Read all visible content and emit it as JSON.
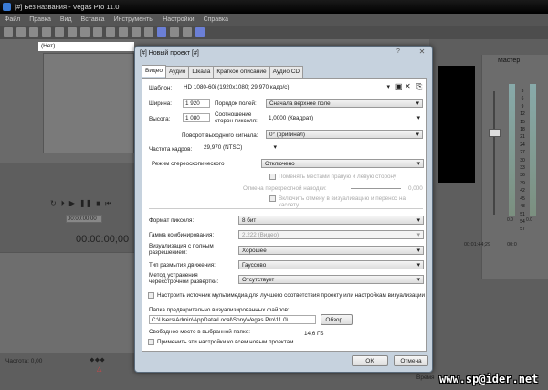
{
  "window": {
    "title": "[#] Без названия - Vegas Pro 11.0"
  },
  "menu": [
    "Файл",
    "Правка",
    "Вид",
    "Вставка",
    "Инструменты",
    "Настройки",
    "Справка"
  ],
  "preview": {
    "preset": "(Нет)",
    "time_small": "00:00:00;00",
    "timecode": "00:00:00;00"
  },
  "timeline": {
    "freq_label": "Частота: 0,00",
    "ruler": [
      "00:01:44;29",
      "00:0"
    ],
    "status": "Время"
  },
  "mixer": {
    "label": "Мастер",
    "scale": [
      "3",
      "6",
      "9",
      "12",
      "15",
      "18",
      "21",
      "24",
      "27",
      "30",
      "33",
      "36",
      "39",
      "42",
      "45",
      "48",
      "51",
      "54",
      "57"
    ],
    "left_level": "0.0",
    "right_level": "0.0"
  },
  "watermark": "www.sp@ider.net",
  "dialog": {
    "title": "[#] Новый проект [#]",
    "help": "?",
    "tabs": [
      "Видео",
      "Аудио",
      "Шкала",
      "Краткое описание",
      "Аудио CD"
    ],
    "template_label": "Шаблон:",
    "template_value": "HD 1080-60i (1920x1080; 29,970 кадр/с)",
    "width_label": "Ширина:",
    "width_value": "1 920",
    "height_label": "Высота:",
    "height_value": "1 080",
    "field_order_label": "Порядок полей:",
    "field_order_value": "Сначала верхнее поле",
    "pixel_aspect_label": "Соотношение сторон пикселя:",
    "pixel_aspect_value": "1,0000 (Квадрат)",
    "rotation_label": "Поворот выходного сигнала:",
    "rotation_value": "0° (оригинал)",
    "frame_rate_label": "Частота кадров:",
    "frame_rate_value": "29,970 (NTSC)",
    "stereo_label": "Режим стереоскопического",
    "stereo_value": "Отключено",
    "swap_label": "Поменять местами правую и левую сторону",
    "crosstalk_label": "Отмена перекрестной наводки:",
    "crosstalk_value": "0,000",
    "crosstalk_apply_label": "Включить отмену в визуализацию и перенос на кассету",
    "pixel_format_label": "Формат пикселя:",
    "pixel_format_value": "8 бит",
    "gamma_label": "Гамма комбинирования:",
    "gamma_value": "2,222 (Видео)",
    "render_quality_label": "Визуализация с полным разрешением:",
    "render_quality_value": "Хорошее",
    "motion_blur_label": "Тип размытия движения:",
    "motion_blur_value": "Гауссово",
    "deinterlace_label": "Метод устранения чересстрочной развёртки:",
    "deinterlace_value": "Отсутствует",
    "adjust_source_label": "Настроить источник мультимедиа для лучшего соответствия проекту или настройкам визуализации",
    "prerender_folder_label": "Папка предварительно визуализированных файлов:",
    "prerender_folder_value": "C:\\Users\\Admin\\AppData\\Local\\Sony\\Vegas Pro\\11.0\\",
    "browse_label": "Обзор...",
    "free_space_label": "Свободное место в выбранной папке:",
    "free_space_value": "14,6 ГБ",
    "apply_all_label": "Применить эти настройки ко всем новым проектам",
    "ok_label": "OK",
    "cancel_label": "Отмена"
  }
}
